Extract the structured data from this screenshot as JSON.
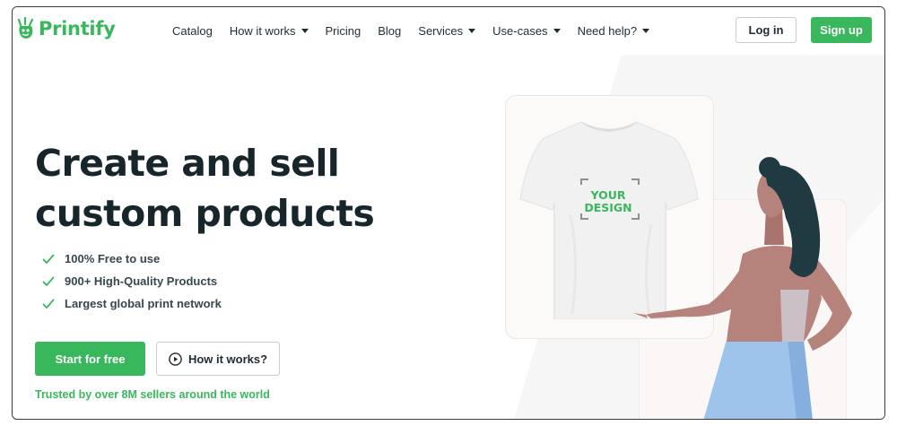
{
  "brand": {
    "name": "Printify",
    "color": "#39b75d"
  },
  "nav": {
    "items": [
      {
        "label": "Catalog",
        "has_dropdown": false
      },
      {
        "label": "How it works",
        "has_dropdown": true
      },
      {
        "label": "Pricing",
        "has_dropdown": false
      },
      {
        "label": "Blog",
        "has_dropdown": false
      },
      {
        "label": "Services",
        "has_dropdown": true
      },
      {
        "label": "Use-cases",
        "has_dropdown": true
      },
      {
        "label": "Need help?",
        "has_dropdown": true
      }
    ],
    "login_label": "Log in",
    "signup_label": "Sign up"
  },
  "hero": {
    "headline_line1": "Create and sell",
    "headline_line2": "custom products",
    "features": [
      "100% Free to use",
      "900+ High-Quality Products",
      "Largest global print network"
    ],
    "cta_primary": "Start for free",
    "cta_secondary": "How it works?",
    "trusted_text": "Trusted by over 8M sellers around the world",
    "mockup_text_line1": "YOUR",
    "mockup_text_line2": "DESIGN"
  },
  "icons": {
    "logo": "printify-logo-icon",
    "check": "check-icon",
    "play": "play-circle-icon",
    "caret": "chevron-down-icon"
  },
  "colors": {
    "accent": "#39b75d",
    "text": "#17262b",
    "skin": "#b5827c",
    "hair": "#1f3a41",
    "skirt": "#8fb9e6"
  }
}
